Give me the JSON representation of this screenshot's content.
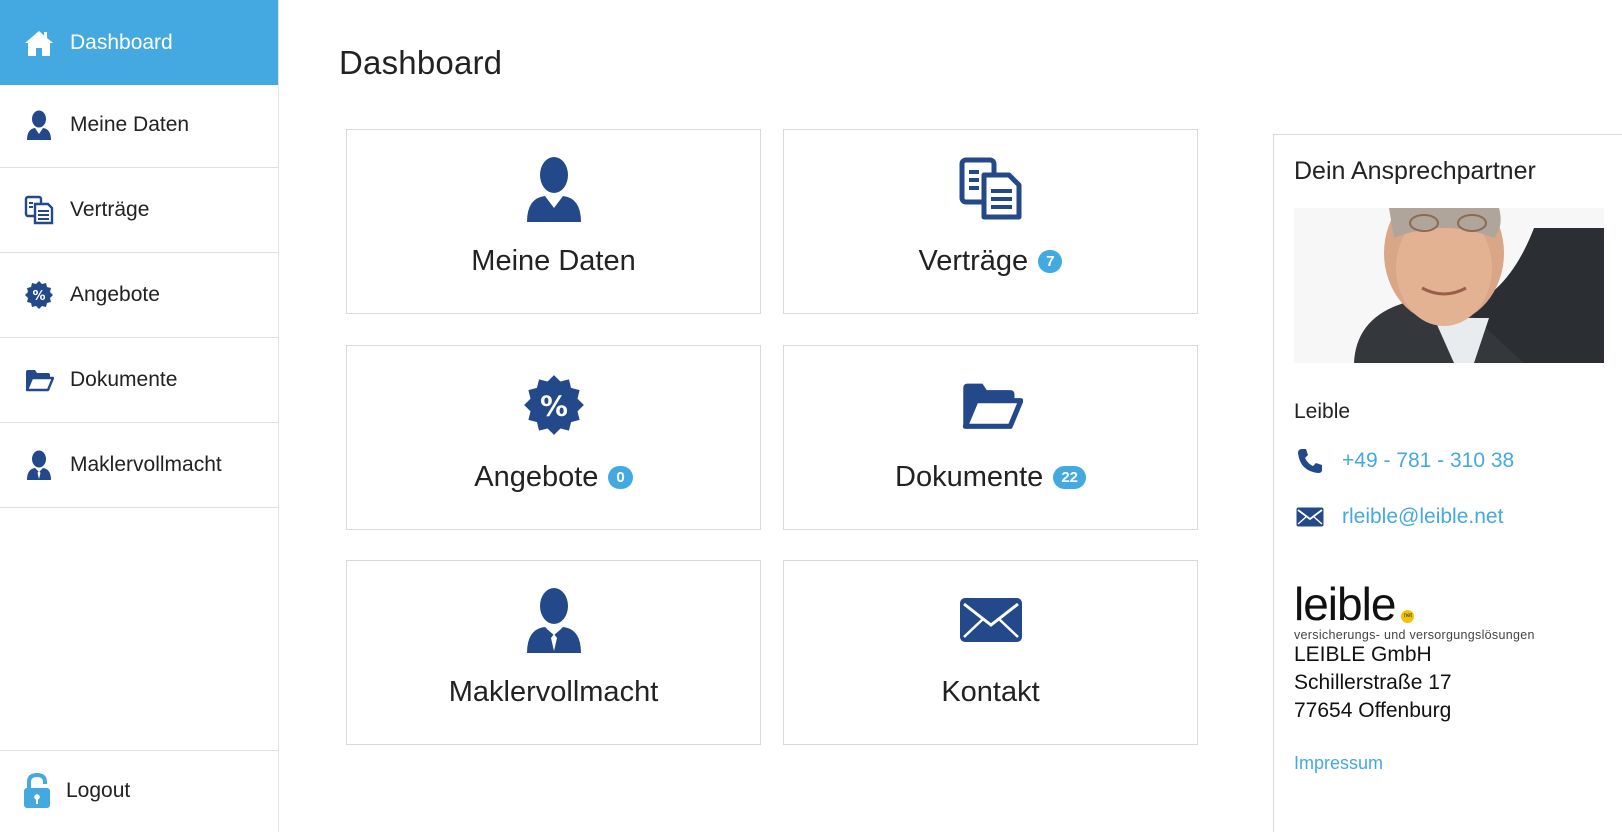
{
  "sidebar": {
    "items": [
      {
        "label": "Dashboard",
        "icon": "home-icon",
        "active": true
      },
      {
        "label": "Meine Daten",
        "icon": "user-icon"
      },
      {
        "label": "Verträge",
        "icon": "documents-icon"
      },
      {
        "label": "Angebote",
        "icon": "percent-badge-icon"
      },
      {
        "label": "Dokumente",
        "icon": "folder-icon"
      },
      {
        "label": "Maklervollmacht",
        "icon": "user-tie-icon"
      }
    ],
    "logout": {
      "label": "Logout",
      "icon": "lock-icon"
    }
  },
  "main": {
    "title": "Dashboard",
    "tiles": [
      {
        "label": "Meine Daten",
        "icon": "user-icon"
      },
      {
        "label": "Verträge",
        "icon": "documents-icon",
        "badge": "7"
      },
      {
        "label": "Angebote",
        "icon": "percent-badge-icon",
        "badge": "0"
      },
      {
        "label": "Dokumente",
        "icon": "folder-icon",
        "badge": "22"
      },
      {
        "label": "Maklervollmacht",
        "icon": "user-tie-icon"
      },
      {
        "label": "Kontakt",
        "icon": "envelope-icon"
      }
    ]
  },
  "contact": {
    "title": "Dein Ansprechpartner",
    "name": "Leible",
    "phone": "+49 - 781 - 310 38",
    "email": "rleible@leible.net",
    "logo": {
      "word": "leible",
      "dot": "net",
      "tagline": "versicherungs- und versorgungslösungen"
    },
    "company": "LEIBLE GmbH",
    "street": "Schillerstraße 17",
    "city": "77654 Offenburg",
    "impressum": "Impressum"
  },
  "colors": {
    "accent": "#45a9e1",
    "icon": "#24498a",
    "text": "#222222",
    "border": "#d9d9d9"
  }
}
